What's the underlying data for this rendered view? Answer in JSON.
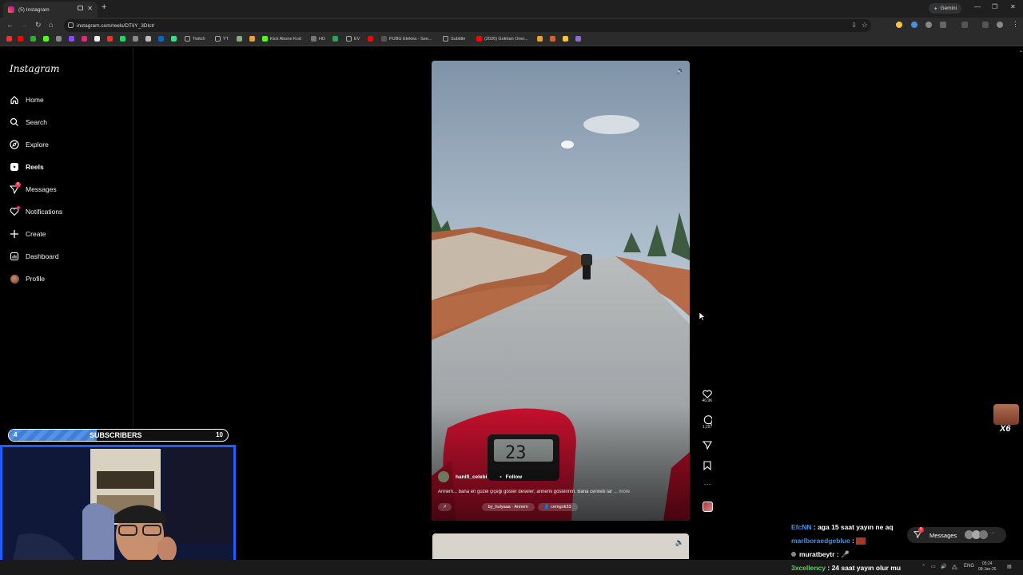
{
  "browser": {
    "tab_title": "(5) Instagram",
    "new_tab": "+",
    "gemini_label": "Gemini",
    "url": "instagram.com/reels/DTIiY_3DIct/",
    "bookmarks": [
      {
        "label": "Twitch",
        "color": "#9146ff",
        "icon": "folder-icon"
      },
      {
        "label": "YT",
        "color": "#aaaaaa",
        "icon": "folder-icon"
      },
      {
        "label": "Kick Abone Kod",
        "color": "#53fc18",
        "icon": "kick-icon"
      },
      {
        "label": "HD",
        "color": "#aaaaaa",
        "icon": "star-icon"
      },
      {
        "label": "EV",
        "color": "#aaaaaa",
        "icon": "folder-icon"
      },
      {
        "label": "PUBG Elektra - See...",
        "color": "#ff0000",
        "icon": "youtube-icon"
      },
      {
        "label": "Subtitle",
        "color": "#aaaaaa",
        "icon": "folder-icon"
      },
      {
        "label": "(2026) Gokhan Oner...",
        "color": "#ff0000",
        "icon": "youtube-icon"
      }
    ]
  },
  "instagram": {
    "logo": "Instagram",
    "nav": [
      {
        "label": "Home",
        "icon": "home-icon"
      },
      {
        "label": "Search",
        "icon": "search-icon"
      },
      {
        "label": "Explore",
        "icon": "compass-icon"
      },
      {
        "label": "Reels",
        "icon": "reels-icon"
      },
      {
        "label": "Messages",
        "icon": "messenger-icon",
        "badge": "5"
      },
      {
        "label": "Notifications",
        "icon": "heart-icon"
      },
      {
        "label": "Create",
        "icon": "plus-icon"
      },
      {
        "label": "Dashboard",
        "icon": "dashboard-icon"
      },
      {
        "label": "Profile",
        "icon": "avatar-icon"
      }
    ],
    "reel": {
      "username": "hanifi_celebi",
      "follow_label": "Follow",
      "separator": "•",
      "caption": "Annem... bana en güzel çiçeği göster deseler; annemi gösteririm. Bana cenneti tar ...",
      "more_label": "more",
      "audio": "by_hulyaaa · Annem",
      "tagged_user": "cemgok33",
      "speedometer": "23",
      "like_count": "46.9K",
      "comment_count": "1,297"
    }
  },
  "overlay": {
    "sub_left": "4",
    "sub_label": "SUBSCRIBERS",
    "sub_right": "10",
    "sub_progress": 0.4,
    "multiplier": "X6",
    "chat": [
      {
        "user": "EfcNN",
        "text": "aga 15 saat yayın ne aq",
        "color": "#4a90e2"
      },
      {
        "user": "marlboraedgeblue",
        "text": "",
        "color": "#4a90e2"
      },
      {
        "user": "muratbeytr",
        "text": "",
        "color": "#ffffff"
      },
      {
        "user": "3xcellency",
        "text": "24 saat yayın olur mu",
        "color": "#5ad16a"
      }
    ],
    "messages_label": "Messages",
    "messages_badge": "5"
  },
  "taskbar": {
    "lang": "ENG",
    "time": "05:24",
    "date": "08-Jan-26"
  }
}
